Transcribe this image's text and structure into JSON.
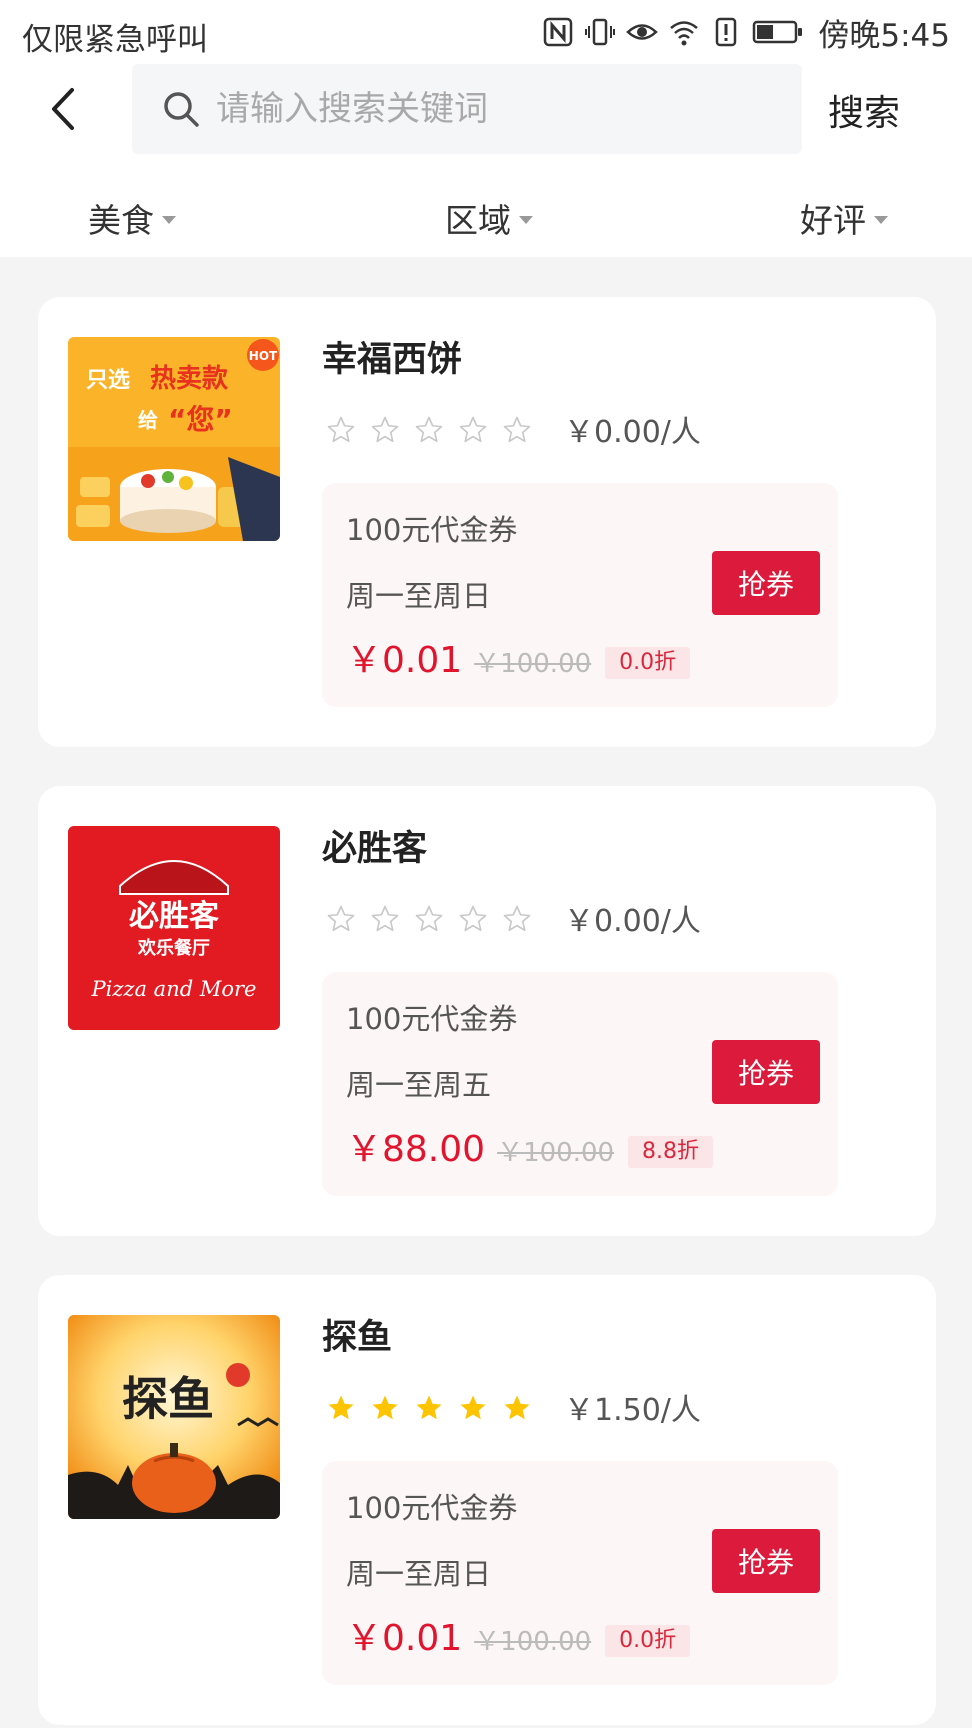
{
  "status_bar": {
    "left_text": "仅限紧急呼叫",
    "time": "傍晚5:45",
    "icons": [
      "nfc-icon",
      "vibrate-icon",
      "eye-icon",
      "wifi-icon",
      "alert-icon",
      "battery-icon"
    ]
  },
  "header": {
    "back_icon": "chevron-left-icon",
    "search_icon": "search-icon",
    "search_placeholder": "请输入搜索关键词",
    "search_value": "",
    "search_button": "搜索"
  },
  "filters": [
    {
      "label": "美食"
    },
    {
      "label": "区域"
    },
    {
      "label": "好评"
    }
  ],
  "shops": [
    {
      "name": "幸福西饼",
      "rating": 0,
      "rating_max": 5,
      "per_person": "￥0.00/人",
      "image_text": [
        "只选",
        "热卖款",
        "给",
        "“您”",
        "HOT"
      ],
      "coupon": {
        "title": "100元代金券",
        "days": "周一至周日",
        "price": "￥0.01",
        "original_price": "￥100.00",
        "discount": "0.0折",
        "button": "抢券"
      }
    },
    {
      "name": "必胜客",
      "rating": 0,
      "rating_max": 5,
      "per_person": "￥0.00/人",
      "image_text": [
        "必胜客",
        "欢乐餐厅",
        "Pizza and More"
      ],
      "coupon": {
        "title": "100元代金券",
        "days": "周一至周五",
        "price": "￥88.00",
        "original_price": "￥100.00",
        "discount": "8.8折",
        "button": "抢券"
      }
    },
    {
      "name": "探鱼",
      "rating": 5,
      "rating_max": 5,
      "per_person": "￥1.50/人",
      "image_text": [
        "探鱼"
      ],
      "coupon": {
        "title": "100元代金券",
        "days": "周一至周日",
        "price": "￥0.01",
        "original_price": "￥100.00",
        "discount": "0.0折",
        "button": "抢券"
      }
    }
  ],
  "colors": {
    "accent": "#dc1a3b",
    "price": "#e0142c",
    "star_filled": "#ffc400",
    "star_empty": "#c8c8c8",
    "page_bg": "#f4f4f4"
  }
}
